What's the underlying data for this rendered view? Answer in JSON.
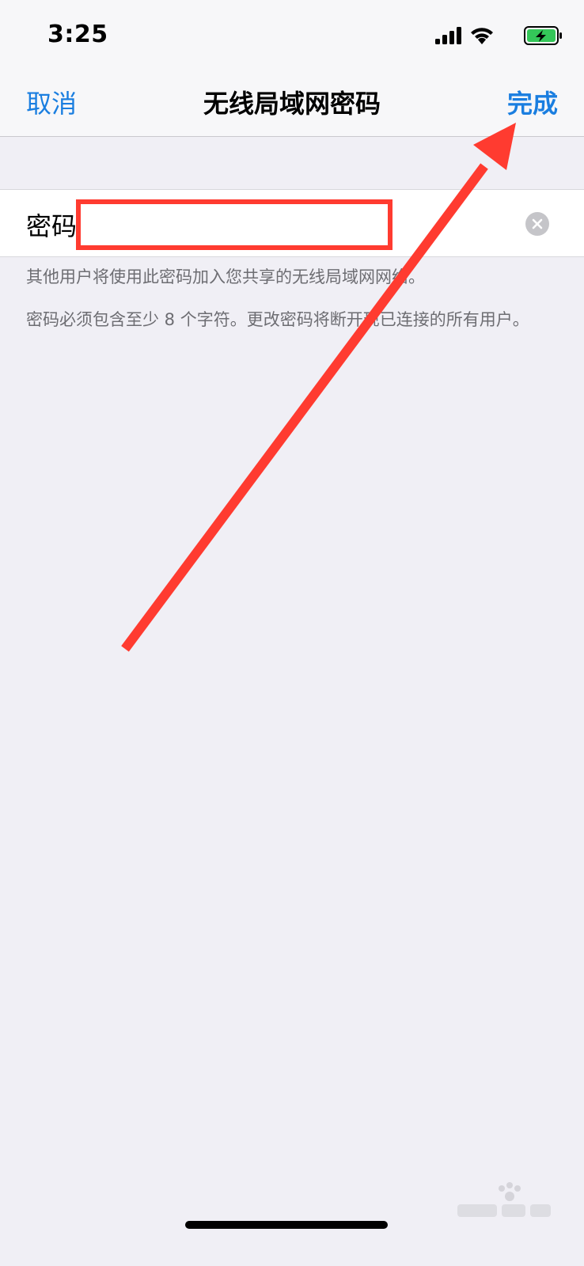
{
  "status_bar": {
    "time": "3:25"
  },
  "nav": {
    "cancel_label": "取消",
    "title": "无线局域网密码",
    "done_label": "完成"
  },
  "password_field": {
    "label": "密码",
    "value": ""
  },
  "footer": {
    "note_1": "其他用户将使用此密码加入您共享的无线局域网网络。",
    "note_2": "密码必须包含至少 8 个字符。更改密码将断开现已连接的所有用户。"
  },
  "icons": {
    "signal": "signal-bars-icon",
    "wifi": "wifi-icon",
    "battery": "battery-charging-icon",
    "clear": "clear-icon"
  },
  "colors": {
    "accent": "#1a7ee0",
    "annotation": "#ff3b30",
    "background": "#f0eff5",
    "battery_fill": "#34c759"
  }
}
